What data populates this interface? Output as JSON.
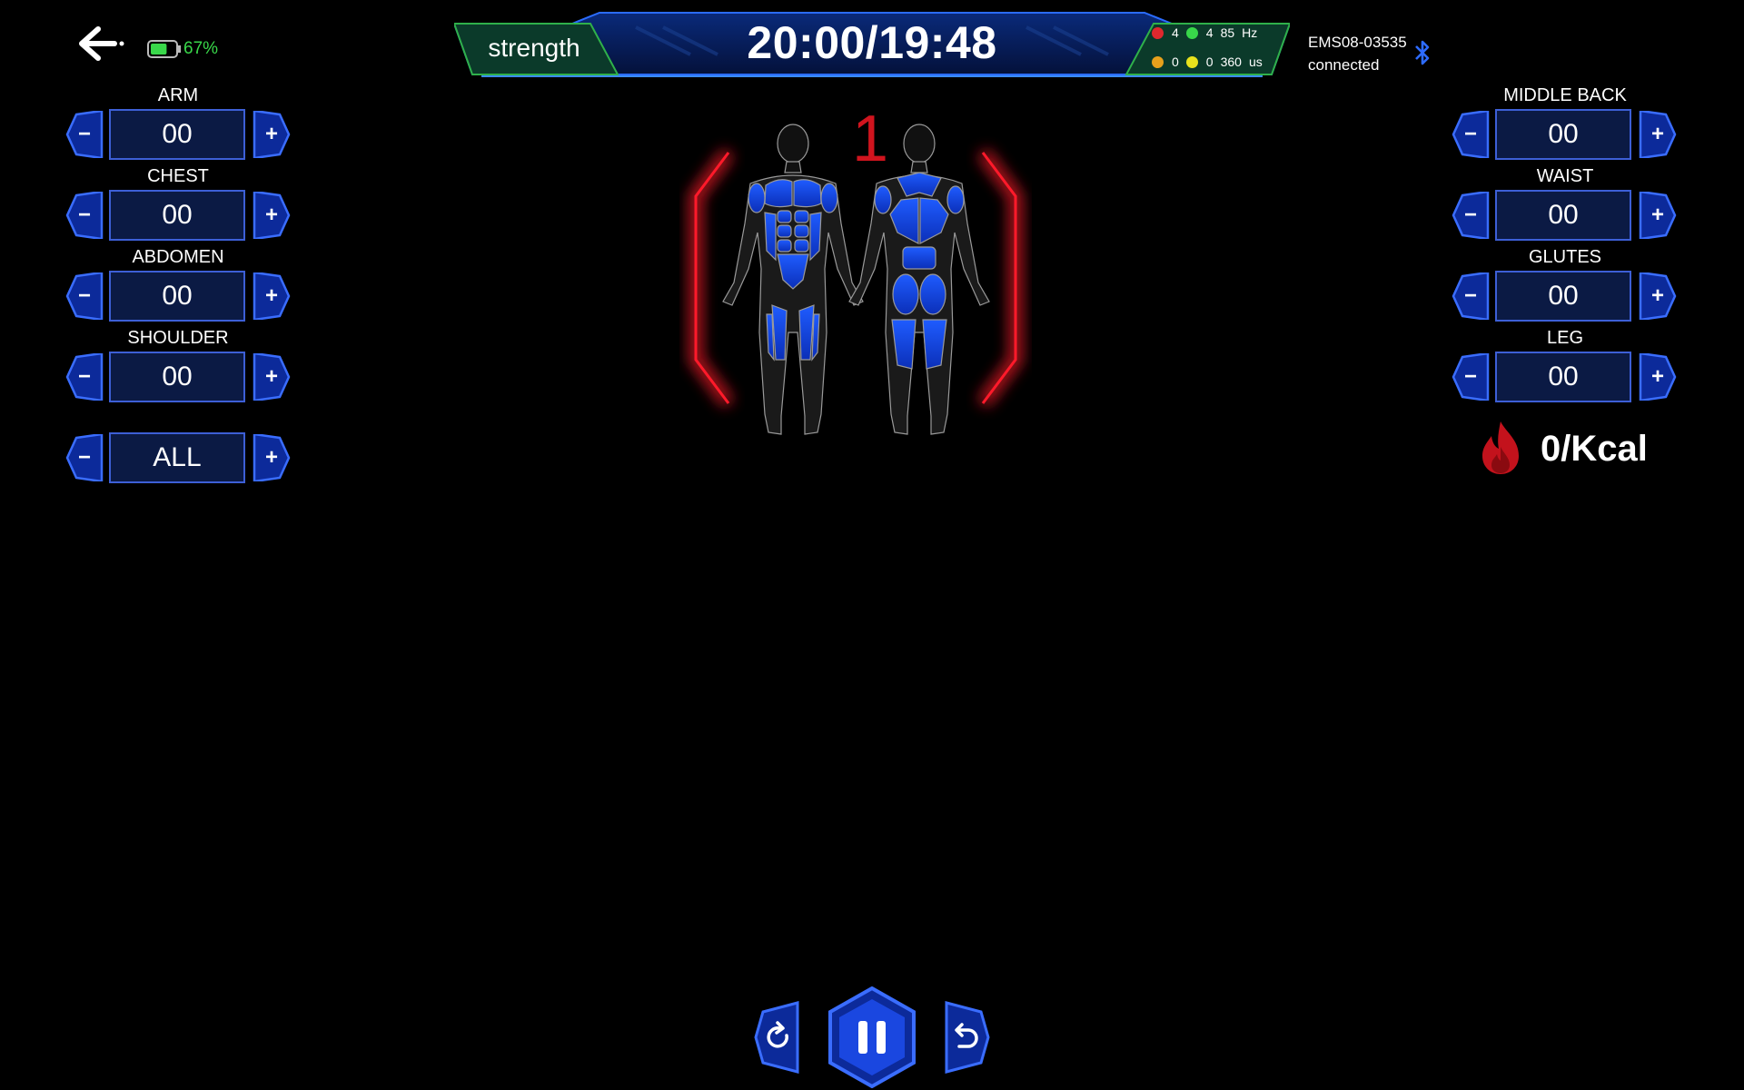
{
  "header": {
    "mode": "strength",
    "timer": "20:00/19:48",
    "battery_percent": "67%",
    "battery_level": 0.67,
    "stats": {
      "row1": {
        "a": "4",
        "b": "4",
        "freq": "85",
        "freq_unit": "Hz"
      },
      "row2": {
        "a": "0",
        "b": "0",
        "pulse": "360",
        "pulse_unit": "us"
      }
    },
    "device": {
      "id": "EMS08-03535",
      "status": "connected"
    }
  },
  "left_channels": [
    {
      "label": "ARM",
      "value": "00"
    },
    {
      "label": "CHEST",
      "value": "00"
    },
    {
      "label": "ABDOMEN",
      "value": "00"
    },
    {
      "label": "SHOULDER",
      "value": "00"
    }
  ],
  "all_channel": {
    "value": "ALL"
  },
  "right_channels": [
    {
      "label": "MIDDLE BACK",
      "value": "00"
    },
    {
      "label": "WAIST",
      "value": "00"
    },
    {
      "label": "GLUTES",
      "value": "00"
    },
    {
      "label": "LEG",
      "value": "00"
    }
  ],
  "buttons": {
    "minus": "−",
    "plus": "+"
  },
  "phase_number": "1",
  "calories": "0/Kcal",
  "colors": {
    "accent_blue": "#1f4fe0",
    "panel_blue": "#0b1a44",
    "battery_green": "#39d84a",
    "alert_red": "#d0141e",
    "mode_green": "#2fb04a"
  }
}
